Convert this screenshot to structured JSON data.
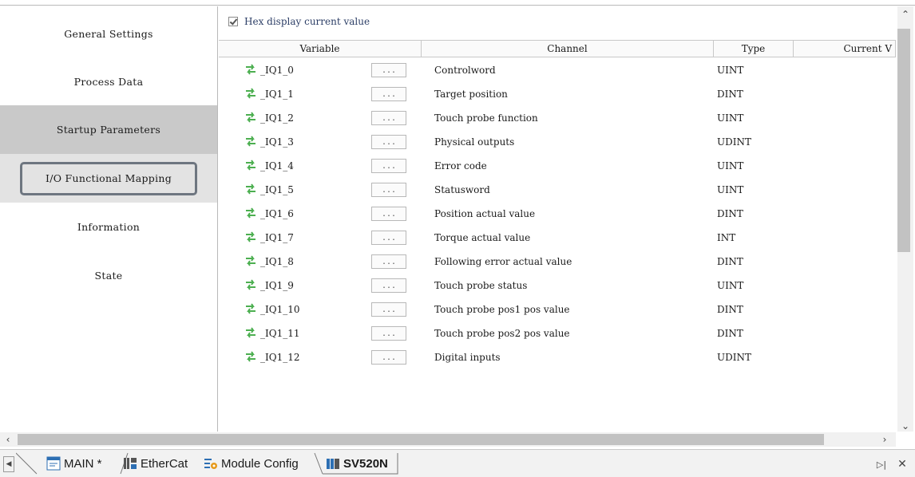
{
  "nav": {
    "items": [
      {
        "label": "General Settings"
      },
      {
        "label": "Process Data"
      },
      {
        "label": "Startup Parameters"
      },
      {
        "label": "I/O Functional Mapping"
      },
      {
        "label": "Information"
      },
      {
        "label": "State"
      }
    ]
  },
  "options": {
    "hex_display_label": "Hex display current value",
    "hex_display_checked": true
  },
  "grid": {
    "headers": [
      "Variable",
      "Channel",
      "Type",
      "Current V"
    ],
    "dots_label": "...",
    "rows": [
      {
        "variable": "_IQ1_0",
        "channel": "Controlword",
        "type": "UINT"
      },
      {
        "variable": "_IQ1_1",
        "channel": "Target position",
        "type": "DINT"
      },
      {
        "variable": "_IQ1_2",
        "channel": "Touch probe function",
        "type": "UINT"
      },
      {
        "variable": "_IQ1_3",
        "channel": "Physical outputs",
        "type": "UDINT"
      },
      {
        "variable": "_IQ1_4",
        "channel": "Error code",
        "type": "UINT"
      },
      {
        "variable": "_IQ1_5",
        "channel": "Statusword",
        "type": "UINT"
      },
      {
        "variable": "_IQ1_6",
        "channel": "Position actual value",
        "type": "DINT"
      },
      {
        "variable": "_IQ1_7",
        "channel": "Torque actual value",
        "type": "INT"
      },
      {
        "variable": "_IQ1_8",
        "channel": "Following error actual value",
        "type": "DINT"
      },
      {
        "variable": "_IQ1_9",
        "channel": "Touch probe status",
        "type": "UINT"
      },
      {
        "variable": "_IQ1_10",
        "channel": "Touch probe pos1 pos value",
        "type": "DINT"
      },
      {
        "variable": "_IQ1_11",
        "channel": "Touch probe pos2 pos value",
        "type": "DINT"
      },
      {
        "variable": "_IQ1_12",
        "channel": "Digital inputs",
        "type": "UDINT"
      }
    ]
  },
  "tabs": [
    {
      "label": "MAIN *",
      "icon": "program-icon"
    },
    {
      "label": "EtherCat",
      "icon": "ethercat-icon"
    },
    {
      "label": "Module Config",
      "icon": "module-config-icon"
    },
    {
      "label": "SV520N",
      "icon": "servo-icon"
    }
  ],
  "colors": {
    "active_nav": "#c9c9c9",
    "hex_label": "#2c3e66",
    "arrows": "#4caf50"
  }
}
